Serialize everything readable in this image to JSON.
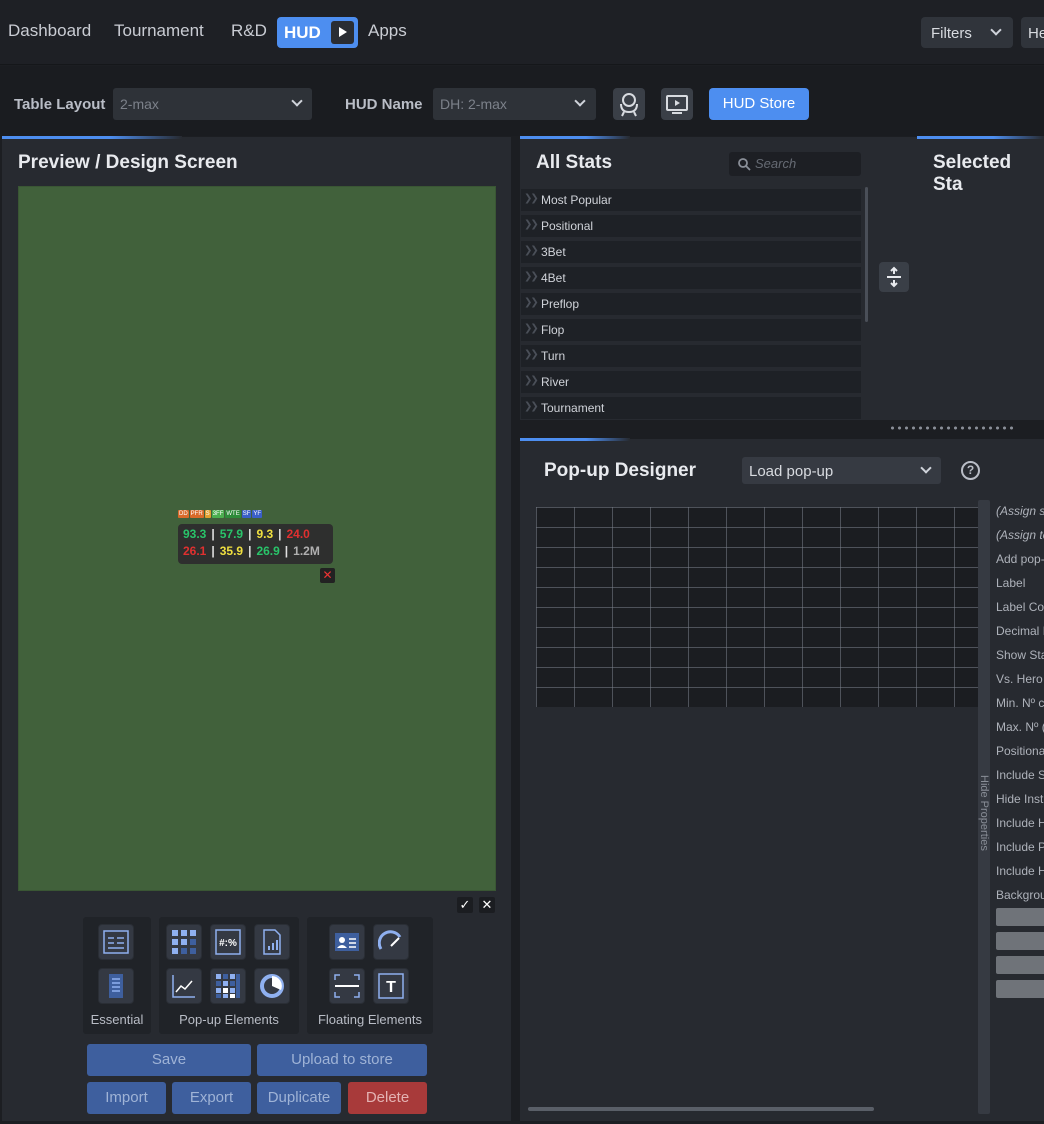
{
  "nav": {
    "items": [
      "Dashboard",
      "Tournament",
      "R&D",
      "HUD",
      "Apps"
    ],
    "filters_label": "Filters",
    "help_label": "He"
  },
  "toolbar": {
    "table_layout_label": "Table Layout",
    "table_layout_value": "2-max",
    "hud_name_label": "HUD Name",
    "hud_name_value": "DH: 2-max",
    "hud_store_label": "HUD Store"
  },
  "preview": {
    "title": "Preview / Design Screen",
    "hud_tags": [
      {
        "text": "DD",
        "color": "#d86a2a"
      },
      {
        "text": "PFR",
        "color": "#d86a2a"
      },
      {
        "text": "S",
        "color": "#e0a030"
      },
      {
        "text": "3FF",
        "color": "#4caf50"
      },
      {
        "text": "WTE",
        "color": "#2e8b3a"
      },
      {
        "text": "SF",
        "color": "#3a5fc8"
      },
      {
        "text": "YF",
        "color": "#3a5fc8"
      }
    ],
    "hud_row1": [
      {
        "text": "93.3",
        "color": "#29c46a"
      },
      {
        "text": "57.9",
        "color": "#29c46a"
      },
      {
        "text": "9.3",
        "color": "#f0e040"
      },
      {
        "text": "24.0",
        "color": "#e03030"
      }
    ],
    "hud_row2": [
      {
        "text": "26.1",
        "color": "#e03030"
      },
      {
        "text": "35.9",
        "color": "#f0e040"
      },
      {
        "text": "26.9",
        "color": "#29c46a"
      },
      {
        "text": "1.2M",
        "color": "#b0b0b0"
      }
    ],
    "groups": [
      "Essential",
      "Pop-up Elements",
      "Floating Elements"
    ],
    "buttons": {
      "save": "Save",
      "upload": "Upload to store",
      "import": "Import",
      "export": "Export",
      "duplicate": "Duplicate",
      "delete": "Delete"
    }
  },
  "all_stats": {
    "title": "All Stats",
    "search_placeholder": "Search",
    "categories": [
      "Most Popular",
      "Positional",
      "3Bet",
      "4Bet",
      "Preflop",
      "Flop",
      "Turn",
      "River",
      "Tournament"
    ]
  },
  "selected_stats": {
    "title": "Selected Sta"
  },
  "popup_designer": {
    "title": "Pop-up Designer",
    "load_label": "Load pop-up",
    "hide_properties": "Hide Properties",
    "properties": [
      "(Assign st",
      "(Assign te",
      "Add pop-",
      "Label",
      "Label Col",
      "Decimal I",
      "Show Sta",
      "Vs. Hero",
      "Min. Nº c",
      "Max. Nº (",
      "Positiona",
      "Include S",
      "Hide Inst",
      "Include H",
      "Include P",
      "Include H",
      "Backgrou"
    ]
  },
  "colors": {
    "accent": "#4d8ef0",
    "delete": "#a83a3a",
    "table_felt": "#41613b"
  }
}
